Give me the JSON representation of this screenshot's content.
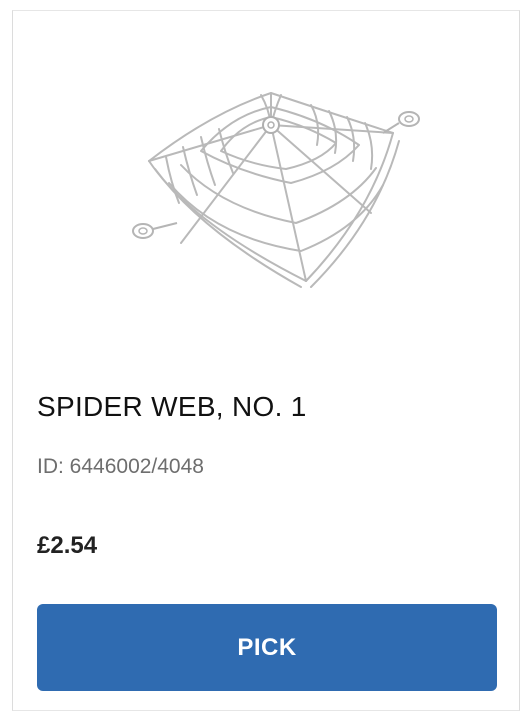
{
  "product": {
    "name": "SPIDER WEB, NO. 1",
    "id_text": "ID: 6446002/4048",
    "price": "£2.54",
    "image_icon": "spider-web-part-image"
  },
  "actions": {
    "pick_label": "PICK"
  },
  "colors": {
    "button_bg": "#2f6bb1",
    "button_text": "#ffffff",
    "muted_text": "#6e6e6e"
  }
}
